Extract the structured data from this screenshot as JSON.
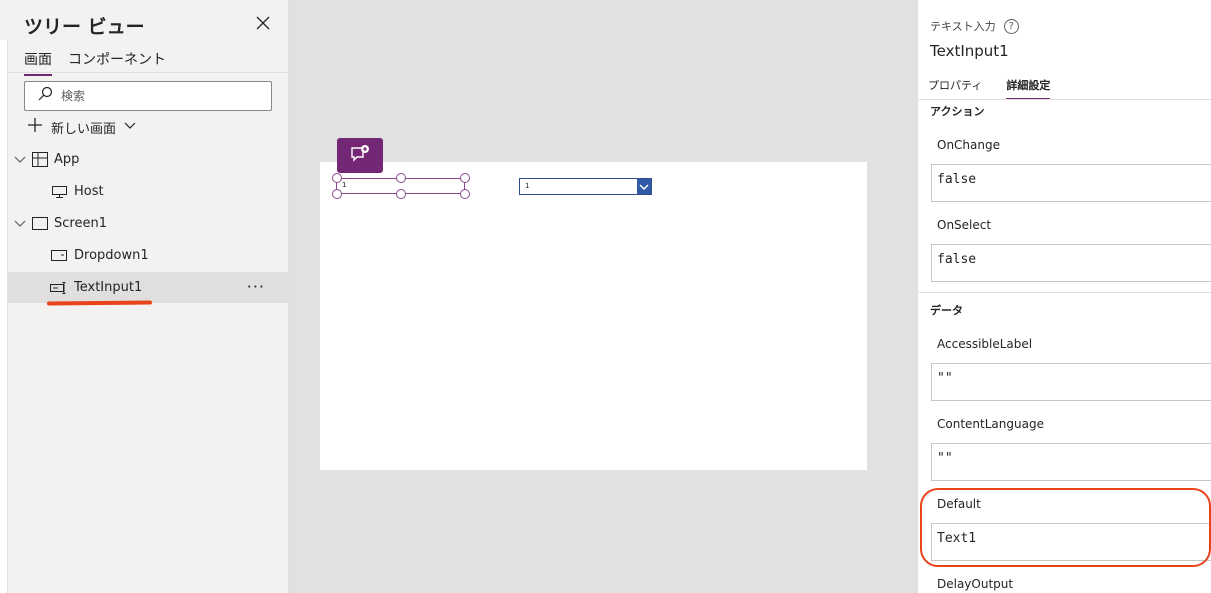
{
  "tree": {
    "title": "ツリー ビュー",
    "tabs": [
      "画面",
      "コンポーネント"
    ],
    "search_placeholder": "検索",
    "new_screen_label": "新しい画面",
    "items": [
      {
        "label": "App"
      },
      {
        "label": "Host"
      },
      {
        "label": "Screen1"
      },
      {
        "label": "Dropdown1"
      },
      {
        "label": "TextInput1"
      }
    ],
    "more_label": "···"
  },
  "canvas": {
    "textinput_value": "1",
    "dropdown_value": "1"
  },
  "props": {
    "control_type": "テキスト入力",
    "help_label": "?",
    "control_name": "TextInput1",
    "tabs": [
      "プロパティ",
      "詳細設定"
    ],
    "sections": {
      "action": "アクション",
      "data": "データ"
    },
    "properties": [
      {
        "name": "OnChange",
        "value": "false"
      },
      {
        "name": "OnSelect",
        "value": "false"
      },
      {
        "name": "AccessibleLabel",
        "value": "\"\""
      },
      {
        "name": "ContentLanguage",
        "value": "\"\""
      },
      {
        "name": "Default",
        "value": "Text1"
      },
      {
        "name": "DelayOutput",
        "value": ""
      }
    ]
  },
  "colors": {
    "accent": "#742774",
    "annotation_red": "#e8431a",
    "dropdown_blue": "#2f5aa8"
  }
}
